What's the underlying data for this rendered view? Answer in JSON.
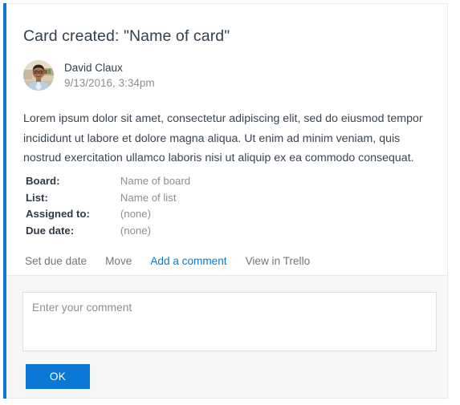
{
  "theme": {
    "accent": "#0a78d4",
    "card_background": "#ffffff",
    "footer_background": "#f7f7f7",
    "title_color": "#32404e",
    "muted_text": "#8a8f94",
    "body_text": "#3b4551",
    "border": "#ebebeb"
  },
  "card": {
    "title": "Card created: \"Name of card\"",
    "author": {
      "name": "David Claux",
      "timestamp": "9/13/2016, 3:34pm",
      "avatar_icon": "user-photo-avatar"
    },
    "description": "Lorem ipsum dolor sit amet, consectetur adipiscing elit, sed do eiusmod tempor incididunt ut labore et dolore magna aliqua. Ut enim ad minim veniam, quis nostrud exercitation ullamco laboris nisi ut aliquip ex ea commodo consequat.",
    "meta": [
      {
        "label": "Board:",
        "value": "Name of board"
      },
      {
        "label": "List:",
        "value": "Name of list"
      },
      {
        "label": "Assigned to:",
        "value": "(none)"
      },
      {
        "label": "Due date:",
        "value": "(none)"
      }
    ],
    "actions": [
      {
        "label": "Set due date",
        "active": false
      },
      {
        "label": "Move",
        "active": false
      },
      {
        "label": "Add a comment",
        "active": true
      },
      {
        "label": "View in Trello",
        "active": false
      }
    ]
  },
  "footer": {
    "comment": {
      "placeholder": "Enter your comment",
      "value": ""
    },
    "submit_label": "OK"
  }
}
